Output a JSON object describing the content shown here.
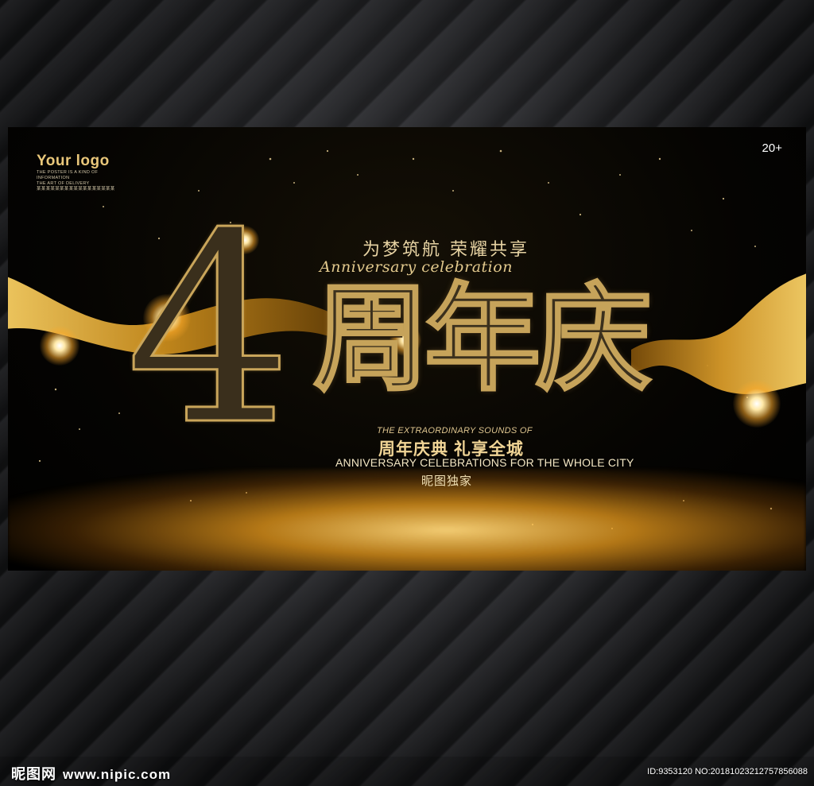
{
  "poster": {
    "logo_title": "Your logo",
    "logo_lines": [
      "THE POSTER IS A KIND OF",
      "INFORMATION",
      "THE ART OF DELIVERY",
      "某某某某某某某某某某某某某某某某某"
    ],
    "age_badge": "20+",
    "slogan": "为梦筑航 荣耀共享",
    "script_text": "Anniversary celebration",
    "big_number": "4",
    "big_title": "周年庆",
    "tagline_small": "THE EXTRAORDINARY SOUNDS OF",
    "tagline_cn": "周年庆典  礼享全城",
    "tagline_en": "ANNIVERSARY CELEBRATIONS FOR THE WHOLE CITY",
    "tagline_brand": "昵图独家"
  },
  "footer": {
    "brand": "昵图网",
    "url": "www.nipic.com",
    "id_text": "ID:9353120 NO:20181023212757856088"
  },
  "colors": {
    "gold": "#c6a35a",
    "gold_light": "#f1d596",
    "background": "#000000"
  }
}
